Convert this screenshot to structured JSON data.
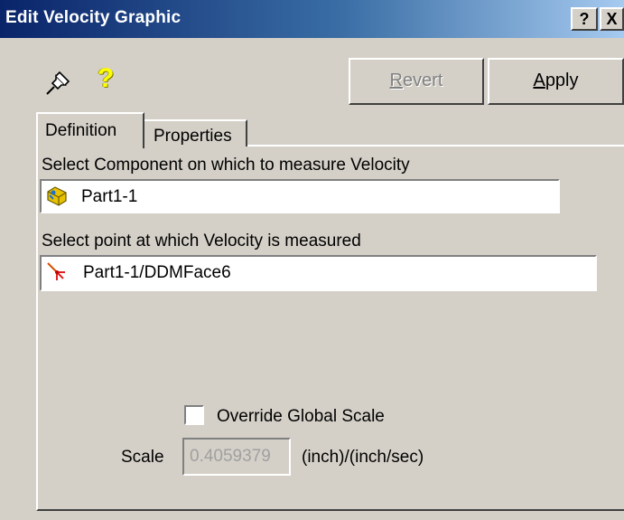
{
  "window": {
    "title": "Edit Velocity Graphic",
    "help_label": "?",
    "close_label": "X"
  },
  "toolbar": {
    "revert_label": "Revert",
    "apply_label": "Apply",
    "pin_icon": "pushpin-icon",
    "help_icon": "question-mark-icon"
  },
  "tabs": [
    {
      "label": "Definition",
      "active": true
    },
    {
      "label": "Properties",
      "active": false
    }
  ],
  "definition": {
    "component_label": "Select Component on which to measure Velocity",
    "component_value": "Part1-1",
    "component_icon": "part-component-icon",
    "point_label": "Select point at which Velocity is measured",
    "point_value": "Part1-1/DDMFace6",
    "point_icon": "point-marker-icon",
    "override_label": "Override Global Scale",
    "override_checked": false,
    "scale_label": "Scale",
    "scale_value": "0.4059379",
    "scale_units": "(inch)/(inch/sec)"
  },
  "colors": {
    "title_start": "#0a246a",
    "title_end": "#a6caf0",
    "face": "#d4d0c8"
  }
}
